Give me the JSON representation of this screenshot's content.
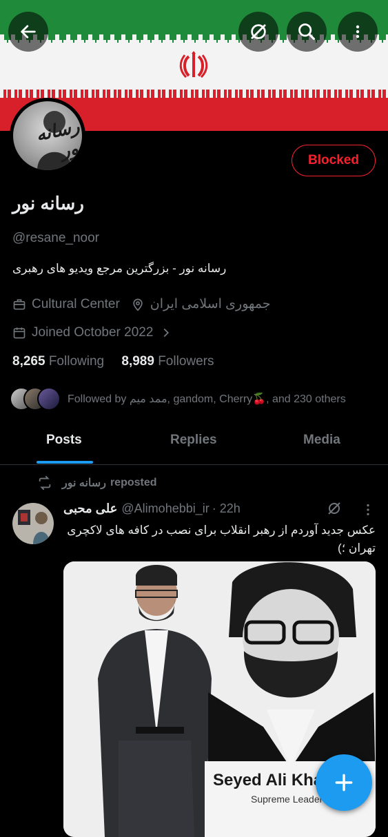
{
  "profile": {
    "display_name": "رسانه نور",
    "handle": "@resane_noor",
    "bio": "رسانه نور - بزرگترین مرجع ویدیو های رهبری",
    "category": "Cultural Center",
    "location": "جمهوری اسلامی ایران",
    "joined": "Joined October 2022",
    "following_count": "8,265",
    "following_label": "Following",
    "followers_count": "8,989",
    "followers_label": "Followers",
    "followed_by": "Followed by ممد میم, gandom, Cherry🍒, and 230 others",
    "avatar_text": "رسانه نور"
  },
  "header": {
    "blocked_label": "Blocked"
  },
  "tabs": [
    {
      "label": "Posts",
      "active": true
    },
    {
      "label": "Replies",
      "active": false
    },
    {
      "label": "Media",
      "active": false
    }
  ],
  "post": {
    "repost_label": "reposted",
    "repost_by": "رسانه نور",
    "author_name": "علی محبی",
    "author_handle": "@Alimohebbi_ir",
    "time": "· 22h",
    "text": "عکس جدید آوردم از رهبر انقلاب برای نصب در کافه های لاکچری تهران ؛)",
    "media_caption_title": "Seyed Ali Khan",
    "media_caption_sub": "Supreme Leader of I"
  },
  "colors": {
    "accent": "#1d9bf0",
    "blocked": "#f4212e",
    "muted": "#71767b",
    "flag_green": "#1f8a3a",
    "flag_red": "#d8202a"
  }
}
